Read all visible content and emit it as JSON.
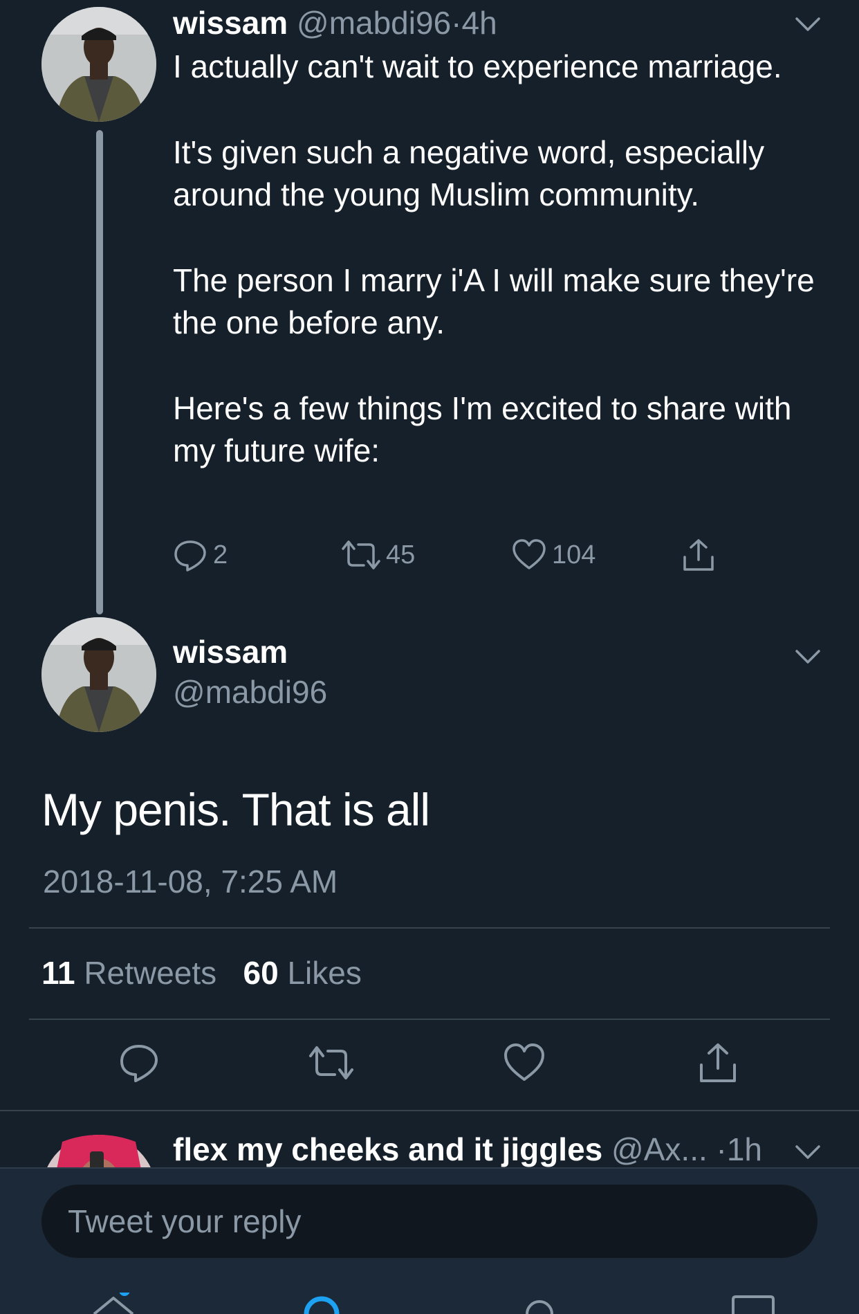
{
  "thread": {
    "tweet1": {
      "name": "wissam",
      "handle": "@mabdi96",
      "separator": "·",
      "time": "4h",
      "paragraphs": [
        "I actually can't wait to experience marriage.",
        "It's given such a negative word, especially around the young Muslim community.",
        "The person I marry i'A I will make sure they're the one before any.",
        "Here's a few things I'm excited to share with my future wife:"
      ],
      "replies": "2",
      "retweets": "45",
      "likes": "104"
    },
    "tweet2": {
      "name": "wissam",
      "handle": "@mabdi96",
      "text": "My penis. That is all",
      "timestamp": "2018-11-08, 7:25 AM",
      "retweet_count": "11",
      "retweet_label": "Retweets",
      "like_count": "60",
      "like_label": "Likes"
    },
    "tweet3": {
      "name": "flex my cheeks and it jiggles",
      "handle": "@Ax...",
      "time": "·1h"
    }
  },
  "reply": {
    "placeholder": "Tweet your reply"
  },
  "colors": {
    "background": "#15202b",
    "muted": "#8b98a5",
    "accent": "#1da1f2"
  },
  "icons": [
    "reply-icon",
    "retweet-icon",
    "like-icon",
    "share-icon",
    "chevron-down-icon",
    "home-icon",
    "search-icon",
    "notifications-icon",
    "messages-icon"
  ]
}
